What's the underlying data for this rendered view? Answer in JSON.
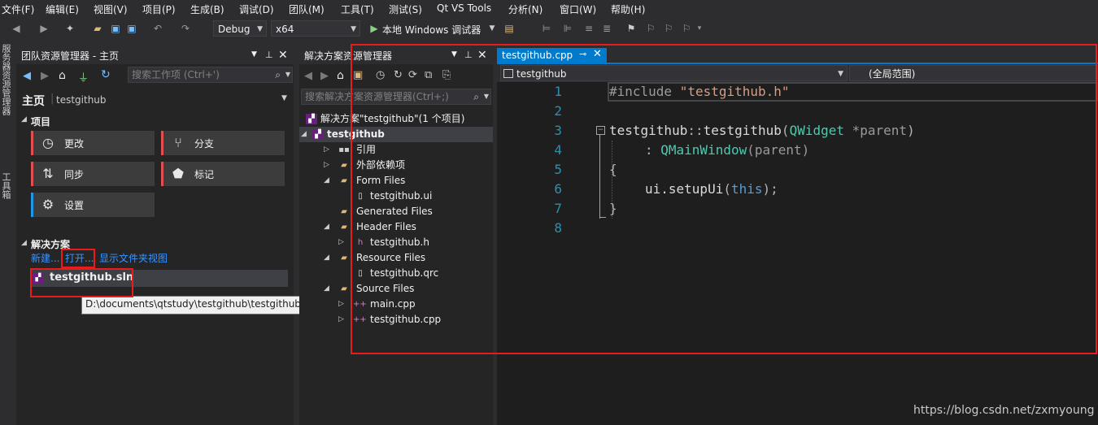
{
  "menu": [
    "文件(F)",
    "编辑(E)",
    "视图(V)",
    "项目(P)",
    "生成(B)",
    "调试(D)",
    "团队(M)",
    "工具(T)",
    "测试(S)",
    "Qt VS Tools",
    "分析(N)",
    "窗口(W)",
    "帮助(H)"
  ],
  "toolbar": {
    "config": "Debug",
    "platform": "x64",
    "run_label": "本地 Windows 调试器"
  },
  "vertical_tabs": [
    "服务器资源管理器",
    "工具箱"
  ],
  "team_explorer": {
    "title": "团队资源管理器 - 主页",
    "search_placeholder": "搜索工作项 (Ctrl+')",
    "home_label": "主页",
    "repo_label": "testgithub",
    "project_section": "项目",
    "tiles": [
      "更改",
      "分支",
      "同步",
      "标记",
      "设置"
    ],
    "solutions_section": "解决方案",
    "links": {
      "new": "新建...",
      "open": "打开...",
      "folder_view": "显示文件夹视图"
    },
    "solution_file": "testgithub.sln",
    "tooltip": "D:\\documents\\qtstudy\\testgithub\\testgithub.sln"
  },
  "solution_explorer": {
    "title": "解决方案资源管理器",
    "search_placeholder": "搜索解决方案资源管理器(Ctrl+;)",
    "solution_root": "解决方案\"testgithub\"(1 个项目)",
    "project": "testgithub",
    "items": [
      "引用",
      "外部依赖项",
      "Form Files",
      "testgithub.ui",
      "Generated Files",
      "Header Files",
      "testgithub.h",
      "Resource Files",
      "testgithub.qrc",
      "Source Files",
      "main.cpp",
      "testgithub.cpp"
    ]
  },
  "editor": {
    "tab_label": "testgithub.cpp",
    "class_combo": "testgithub",
    "scope_combo": "(全局范围)",
    "line_numbers": [
      "1",
      "2",
      "3",
      "4",
      "5",
      "6",
      "7",
      "8"
    ],
    "code": {
      "l1_directive": "#include",
      "l1_string": "\"testgithub.h\"",
      "l3_class": "testgithub",
      "l3_scope": "::",
      "l3_func": "testgithub",
      "l3_paren_open": "(",
      "l3_type": "QWidget",
      "l3_param": " *parent",
      "l3_paren_close": ")",
      "l4_colon": ": ",
      "l4_base": "QMainWindow",
      "l4_args": "(parent)",
      "l5": "{",
      "l6_obj": "ui.setupUi",
      "l6_open": "(",
      "l6_kw": "this",
      "l6_close": ");",
      "l7": "}"
    }
  },
  "watermark": "https://blog.csdn.net/zxmyoung",
  "colors": {
    "accent": "#007acc",
    "highlight_box": "#e81c1c",
    "link": "#3794ff"
  }
}
